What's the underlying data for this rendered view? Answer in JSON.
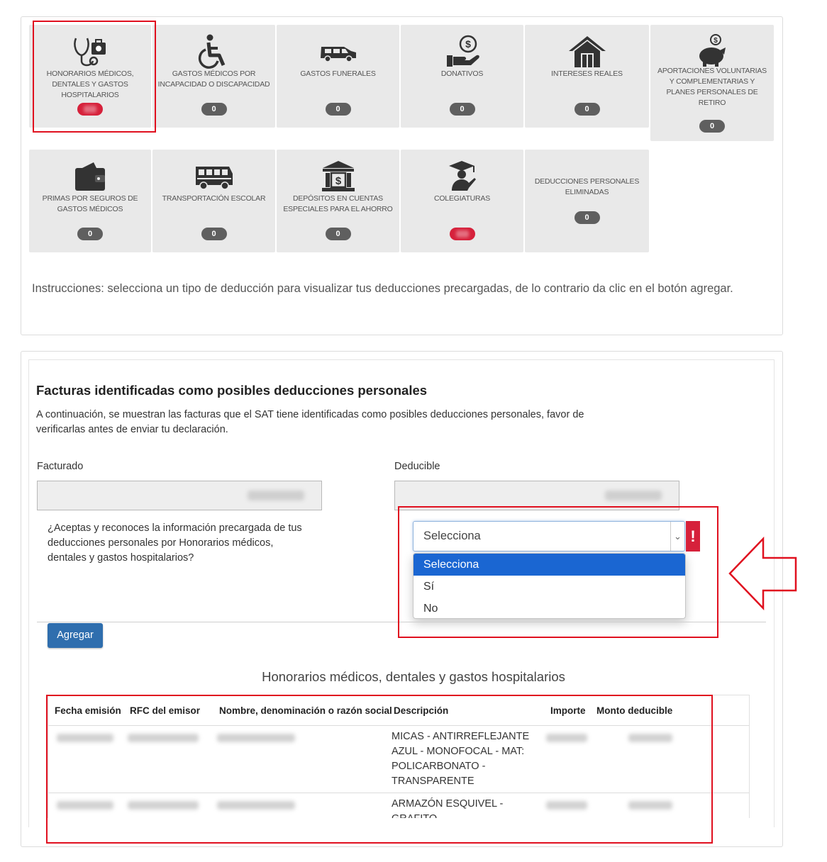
{
  "deduction_types": [
    {
      "label": "Honorarios médicos, dentales y gastos hospitalarios",
      "icon": "medical-icon",
      "count": "",
      "badge_status": "active"
    },
    {
      "label": "Gastos médicos por incapacidad o discapacidad",
      "icon": "wheelchair-icon",
      "count": "0"
    },
    {
      "label": "Gastos funerales",
      "icon": "hearse-icon",
      "count": "0"
    },
    {
      "label": "Donativos",
      "icon": "donation-icon",
      "count": "0"
    },
    {
      "label": "Intereses reales",
      "icon": "house-icon",
      "count": "0"
    },
    {
      "label": "Aportaciones voluntarias y complementarias y planes personales de retiro",
      "icon": "piggy-bank-icon",
      "count": "0"
    },
    {
      "label": "Primas por seguros de gastos médicos",
      "icon": "wallet-icon",
      "count": "0"
    },
    {
      "label": "Transportación escolar",
      "icon": "school-bus-icon",
      "count": "0"
    },
    {
      "label": "Depósitos en cuentas especiales para el ahorro",
      "icon": "bank-icon",
      "count": "0"
    },
    {
      "label": "Colegiaturas",
      "icon": "graduation-icon",
      "count": "",
      "badge_status": "active"
    },
    {
      "label": "Deducciones personales eliminadas",
      "icon": "",
      "count": "0"
    }
  ],
  "instructions": "Instrucciones: selecciona un tipo de deducción para visualizar tus deducciones precargadas, de lo contrario da clic en el botón agregar.",
  "invoices_section": {
    "title": "Facturas identificadas como posibles deducciones personales",
    "description": "A continuación, se muestran las facturas que el SAT tiene identificadas como posibles deducciones personales, favor de verificarlas antes de enviar tu declaración.",
    "billed_label": "Facturado",
    "deductible_label": "Deducible",
    "question": "¿Aceptas y reconoces la información precargada de tus deducciones personales por Honorarios médicos, dentales y gastos hospitalarios?",
    "select_value": "Selecciona",
    "select_options": [
      "Selecciona",
      "Sí",
      "No"
    ],
    "add_button": "Agregar"
  },
  "table": {
    "title": "Honorarios médicos, dentales y gastos hospitalarios",
    "headers": [
      "Fecha emisión",
      "RFC del emisor",
      "Nombre, denominación o razón social",
      "Descripción",
      "Importe",
      "Monto deducible"
    ],
    "rows": [
      {
        "description": "MICAS - ANTIRREFLEJANTE AZUL - MONOFOCAL - MAT: POLICARBONATO - TRANSPARENTE"
      },
      {
        "description": "ARMAZÓN ESQUIVEL - GRAFITO"
      }
    ]
  },
  "colors": {
    "accent_red": "#d6213b",
    "button_blue": "#2f6eae",
    "highlight_red": "#e0101f",
    "selected_option": "#1a66d2"
  }
}
